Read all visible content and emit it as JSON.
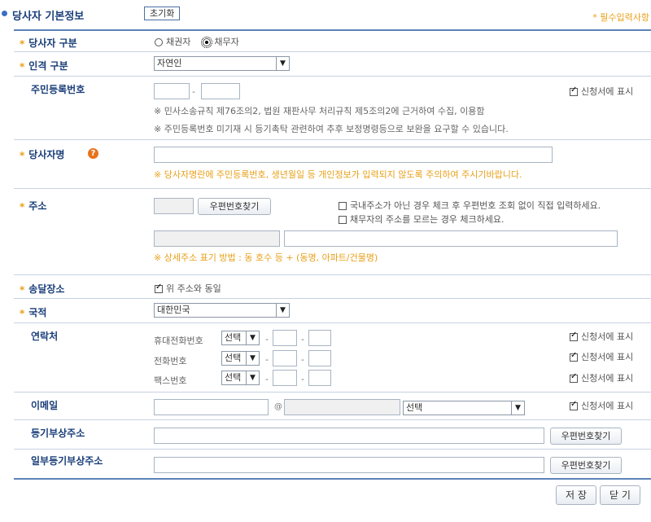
{
  "header": {
    "title": "당사자 기본정보",
    "reset_label": "초기화",
    "required_note": "* 필수입력사항"
  },
  "party_type": {
    "label": "당사자 구분",
    "options": [
      "채권자",
      "채무자"
    ],
    "selected": "채무자"
  },
  "person_type": {
    "label": "인격 구분",
    "value": "자연인"
  },
  "rrn": {
    "label": "주민등록번호",
    "show_label": "신청서에 표시",
    "note1": "※ 민사소송규칙 제76조의2, 법원 재판사무 처리규칙 제5조의2에 근거하여 수집, 이용함",
    "note2": "※ 주민등록번호 미기재 시 등기촉탁 관련하여 추후 보정명령등으로 보완을 요구할 수 있습니다."
  },
  "name": {
    "label": "당사자명",
    "warning": "※ 당사자명란에 주민등록번호, 생년월일 등 개인정보가 입력되지 않도록 주의하여 주시기바랍니다."
  },
  "address": {
    "label": "주소",
    "zip_button": "우편번호찾기",
    "check_overseas": "국내주소가 아닌 경우 체크 후 우편번호 조회 없이 직접 입력하세요.",
    "check_unknown": "채무자의 주소를 모르는 경우 체크하세요.",
    "detail_note": "※ 상세주소 표기 방법 : 동 호수 등 + (동명, 아파트/건물명)"
  },
  "delivery": {
    "label": "송달장소",
    "same_label": "위 주소와 동일"
  },
  "nationality": {
    "label": "국적",
    "value": "대한민국"
  },
  "contact": {
    "label": "연락처",
    "rows": [
      {
        "type": "휴대전화번호",
        "select": "선택",
        "show": "신청서에 표시"
      },
      {
        "type": "전화번호",
        "select": "선택",
        "show": "신청서에 표시"
      },
      {
        "type": "팩스번호",
        "select": "선택",
        "show": "신청서에 표시"
      }
    ]
  },
  "email": {
    "label": "이메일",
    "at": "@",
    "domain_select": "선택",
    "show": "신청서에 표시"
  },
  "registry_addr": {
    "label": "등기부상주소",
    "zip_button": "우편번호찾기"
  },
  "partial_registry_addr": {
    "label": "일부등기부상주소",
    "zip_button": "우편번호찾기"
  },
  "footer": {
    "save_label": "저 장",
    "close_label": "닫 기"
  }
}
